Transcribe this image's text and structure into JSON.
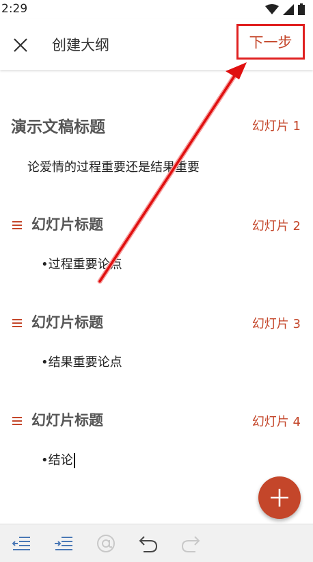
{
  "status": {
    "time": "2:29",
    "icons": [
      "wifi-icon",
      "signal-icon",
      "battery-icon"
    ]
  },
  "header": {
    "title": "创建大纲",
    "next_label": "下一步",
    "close_icon": "close-icon"
  },
  "presentation": {
    "title": "演示文稿标题",
    "subtitle": "论爱情的过程重要还是结果重要",
    "slide_label": "幻灯片 1"
  },
  "slides": [
    {
      "title": "幻灯片标题",
      "label": "幻灯片 2",
      "bullet": "•过程重要论点"
    },
    {
      "title": "幻灯片标题",
      "label": "幻灯片 3",
      "bullet": "•结果重要论点"
    },
    {
      "title": "幻灯片标题",
      "label": "幻灯片 4",
      "bullet": "•结论"
    }
  ],
  "toolbar": {
    "tools": [
      "outdent-icon",
      "indent-icon",
      "at-icon",
      "undo-icon",
      "redo-icon"
    ]
  },
  "colors": {
    "accent": "#c4462a",
    "annotation": "#e02020",
    "toolbar_bg": "#f1f1f1"
  }
}
